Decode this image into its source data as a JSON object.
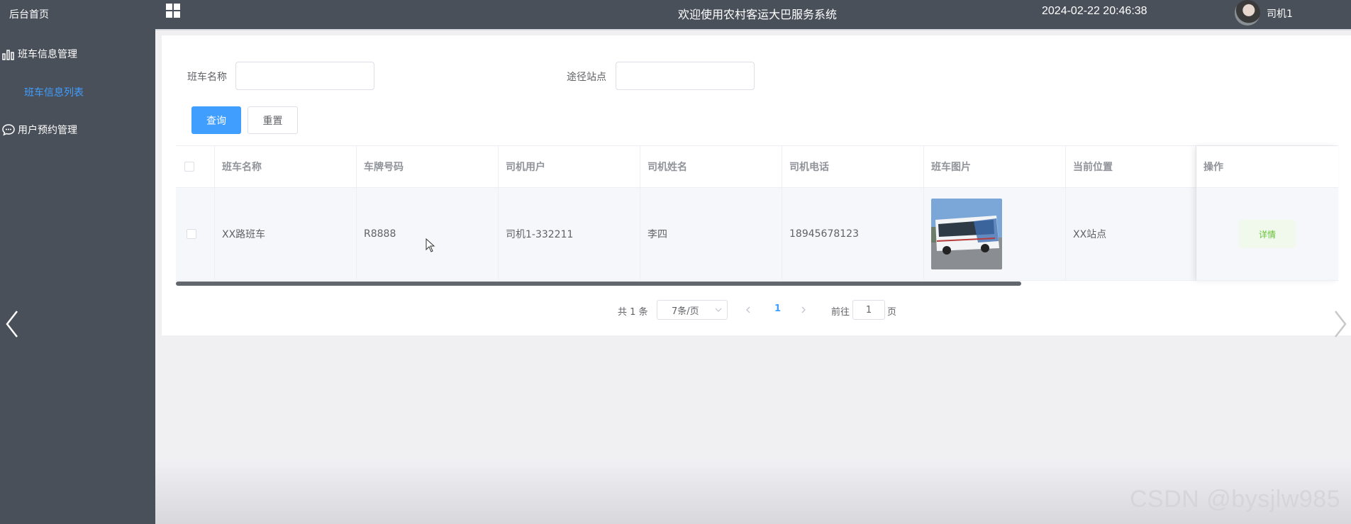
{
  "sidebar": {
    "home": "后台首页",
    "groups": [
      {
        "label": "班车信息管理",
        "icon": "bar-chart-icon",
        "items": [
          {
            "label": "班车信息列表"
          }
        ]
      },
      {
        "label": "用户预约管理",
        "icon": "chat-icon",
        "items": []
      }
    ]
  },
  "header": {
    "title": "欢迎使用农村客运大巴服务系统",
    "datetime": "2024-02-22 20:46:38",
    "username": "司机1"
  },
  "search": {
    "fields": [
      {
        "label": "班车名称",
        "value": "",
        "placeholder": ""
      },
      {
        "label": "途径站点",
        "value": "",
        "placeholder": ""
      }
    ],
    "query_label": "查询",
    "reset_label": "重置"
  },
  "table": {
    "columns": [
      "班车名称",
      "车牌号码",
      "司机用户",
      "司机姓名",
      "司机电话",
      "班车图片",
      "当前位置",
      "操作"
    ],
    "rows": [
      {
        "name": "XX路班车",
        "plate": "R8888",
        "driver_user": "司机1-332211",
        "driver_name": "李四",
        "driver_phone": "18945678123",
        "image": "bus-photo",
        "location": "XX站点",
        "action_label": "详情"
      }
    ]
  },
  "pagination": {
    "total_label": "共 1 条",
    "page_size_label": "7条/页",
    "current_page": "1",
    "goto_prefix": "前往",
    "goto_value": "1",
    "goto_suffix": "页"
  },
  "watermark": "CSDN @bysjlw985",
  "colors": {
    "sidebar_bg": "#4a5059",
    "accent": "#409eff",
    "success_text": "#67c23a",
    "success_bg": "#f0f9eb",
    "page_bg": "#f0f0f3"
  }
}
